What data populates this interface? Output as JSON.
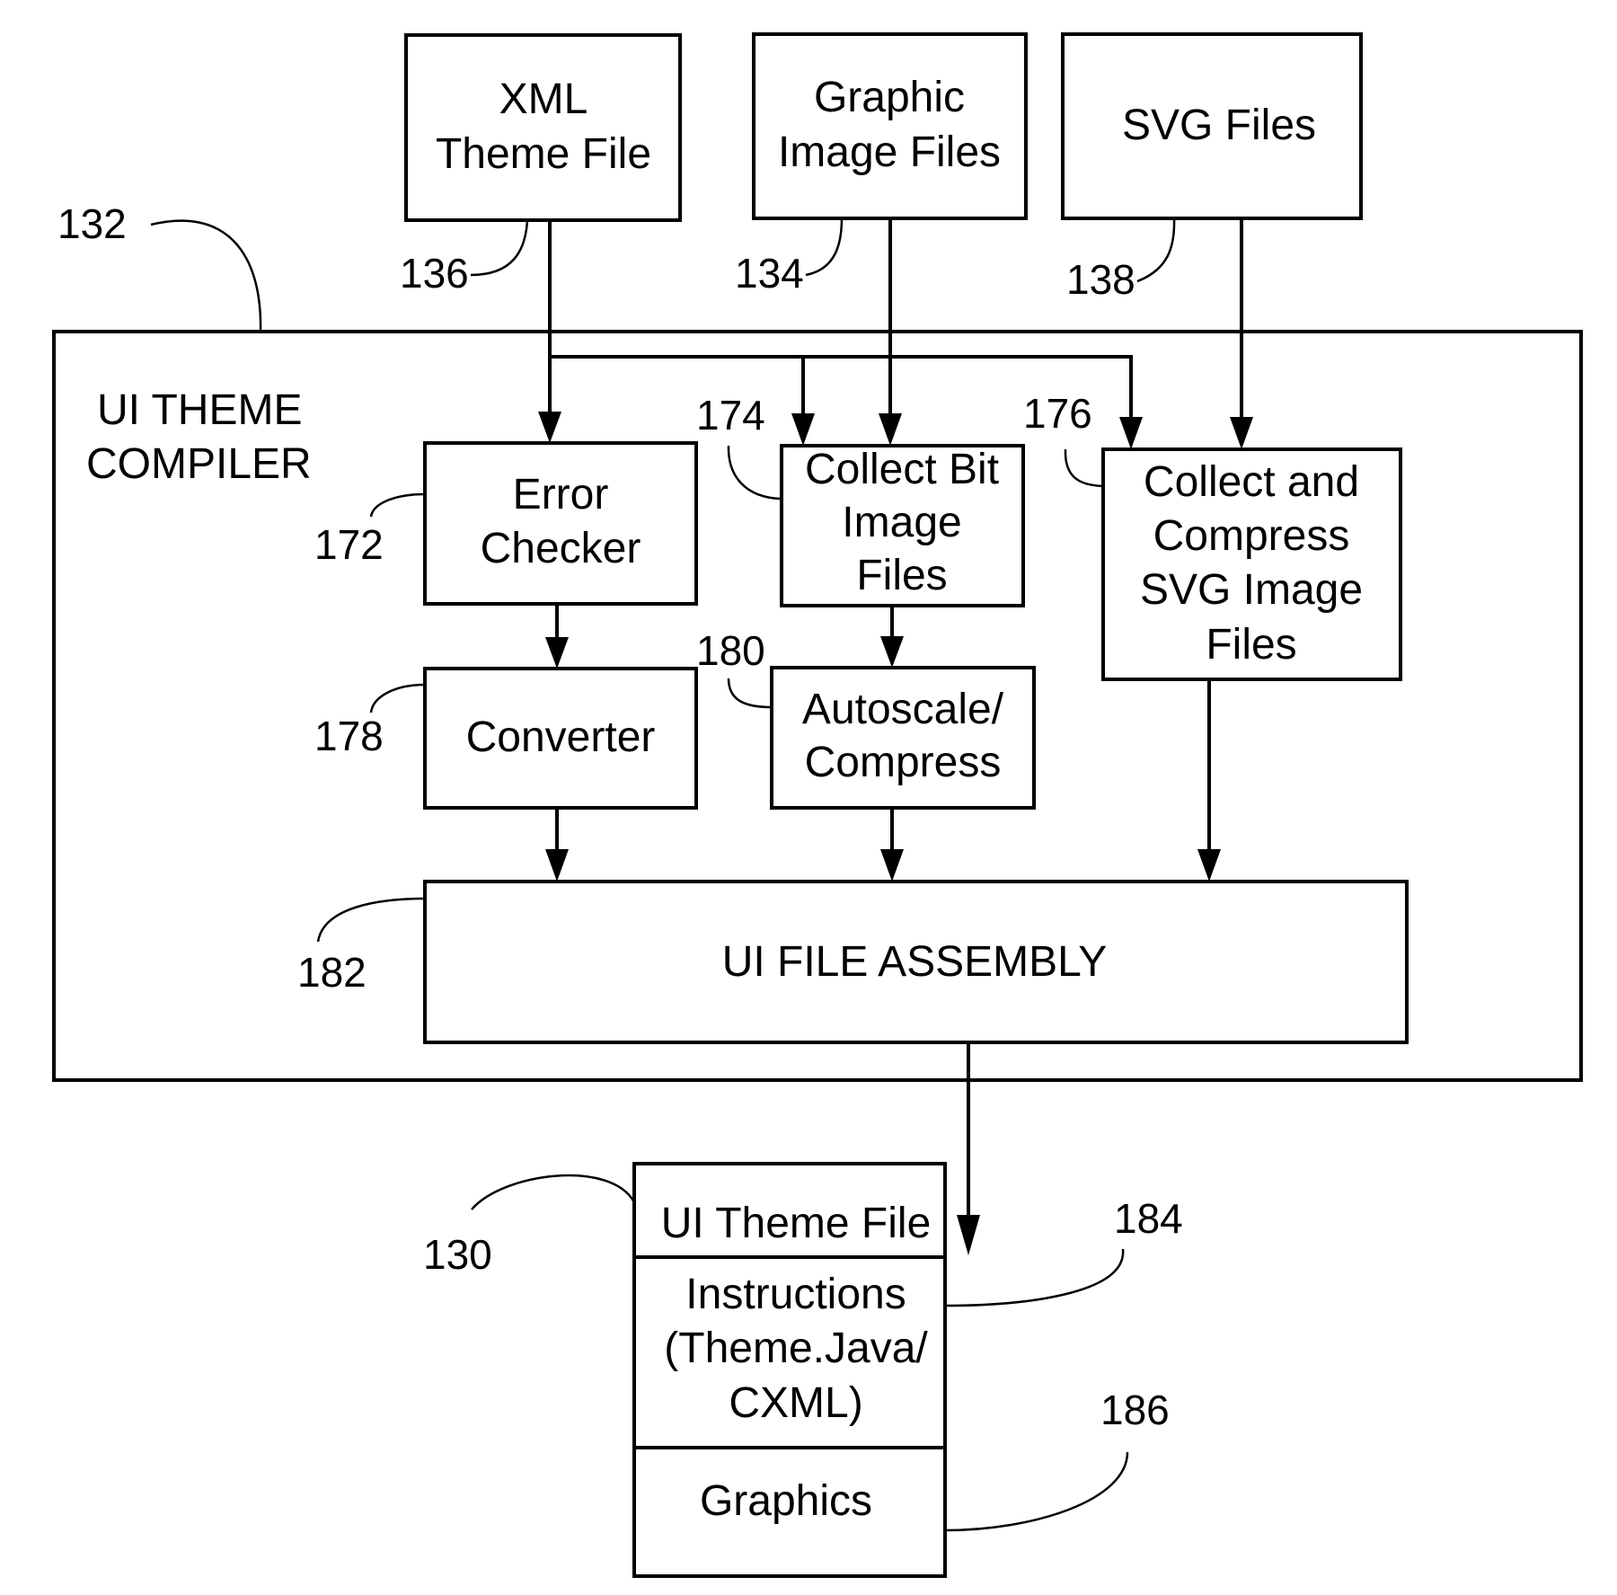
{
  "inputs": {
    "xml_theme_file": {
      "lines": [
        "XML",
        "Theme File"
      ],
      "ref": "136"
    },
    "graphic_image_files": {
      "lines": [
        "Graphic",
        "Image Files"
      ],
      "ref": "134"
    },
    "svg_files": {
      "lines": [
        "SVG Files"
      ],
      "ref": "138"
    }
  },
  "compiler": {
    "title_lines": [
      "UI THEME",
      "COMPILER"
    ],
    "ref": "132",
    "blocks": {
      "error_checker": {
        "lines": [
          "Error",
          "Checker"
        ],
        "ref": "172"
      },
      "collect_bit_image": {
        "lines": [
          "Collect Bit",
          "Image",
          "Files"
        ],
        "ref": "174"
      },
      "collect_compress_svg": {
        "lines": [
          "Collect and",
          "Compress",
          "SVG Image",
          "Files"
        ],
        "ref": "176"
      },
      "converter": {
        "lines": [
          "Converter"
        ],
        "ref": "178"
      },
      "autoscale_compress": {
        "lines": [
          "Autoscale/",
          "Compress"
        ],
        "ref": "180"
      },
      "ui_file_assembly": {
        "lines": [
          "UI FILE ASSEMBLY"
        ],
        "ref": "182"
      }
    }
  },
  "output": {
    "ref": "130",
    "sections": {
      "header": {
        "lines": [
          "UI Theme File"
        ]
      },
      "instructions": {
        "lines": [
          "Instructions",
          "(Theme.Java/",
          "CXML)"
        ],
        "ref": "184"
      },
      "graphics": {
        "lines": [
          "Graphics"
        ],
        "ref": "186"
      }
    }
  }
}
